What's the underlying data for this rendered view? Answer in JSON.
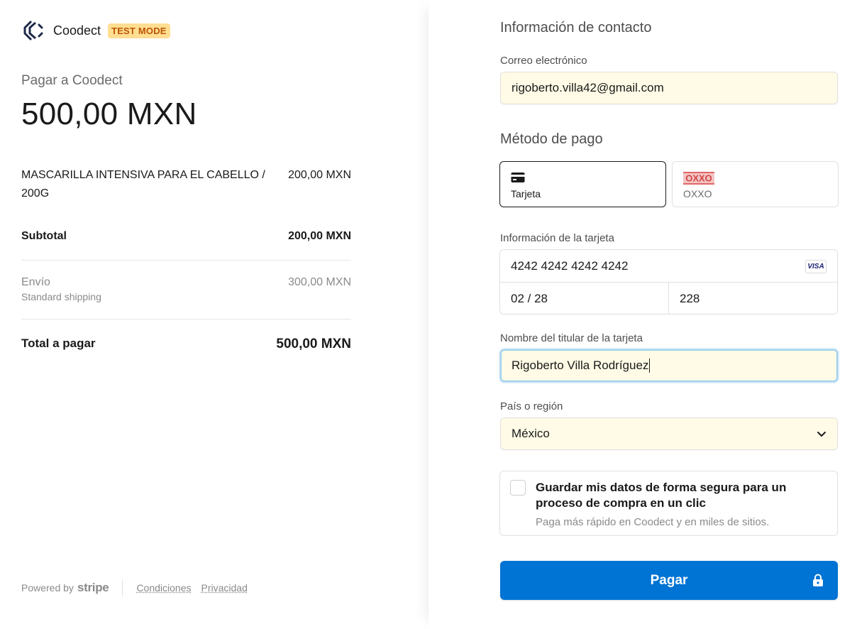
{
  "merchant": {
    "name": "Coodect",
    "test_badge": "TEST MODE"
  },
  "summary": {
    "pay_to": "Pagar a Coodect",
    "amount": "500,00 MXN",
    "item": {
      "name": "MASCARILLA INTENSIVA PARA EL CABELLO / 200G",
      "price": "200,00 MXN"
    },
    "subtotal_label": "Subtotal",
    "subtotal_value": "200,00 MXN",
    "shipping_label": "Envío",
    "shipping_method": "Standard shipping",
    "shipping_value": "300,00 MXN",
    "total_label": "Total a pagar",
    "total_value": "500,00 MXN"
  },
  "footer": {
    "powered_by": "Powered by",
    "stripe": "stripe",
    "terms": "Condiciones",
    "privacy": "Privacidad"
  },
  "contact": {
    "title": "Información de contacto",
    "email_label": "Correo electrónico",
    "email_value": "rigoberto.villa42@gmail.com"
  },
  "payment_method": {
    "title": "Método de pago",
    "options": [
      {
        "label": "Tarjeta",
        "selected": true,
        "icon": "credit-card-icon"
      },
      {
        "label": "OXXO",
        "selected": false,
        "icon": "oxxo-logo-icon"
      }
    ]
  },
  "card": {
    "label": "Información de la tarjeta",
    "number": "4242 4242 4242 4242",
    "brand": "VISA",
    "expiry": "02 / 28",
    "cvc": "228"
  },
  "cardholder": {
    "label": "Nombre del titular de la tarjeta",
    "value": "Rigoberto Villa Rodríguez"
  },
  "country": {
    "label": "País o región",
    "value": "México"
  },
  "save_info": {
    "title": "Guardar mis datos de forma segura para un proceso de compra en un clic",
    "subtitle": "Paga más rápido en Coodect y en miles de sitios.",
    "checked": false
  },
  "pay_button": {
    "label": "Pagar",
    "color": "#0074d4"
  }
}
